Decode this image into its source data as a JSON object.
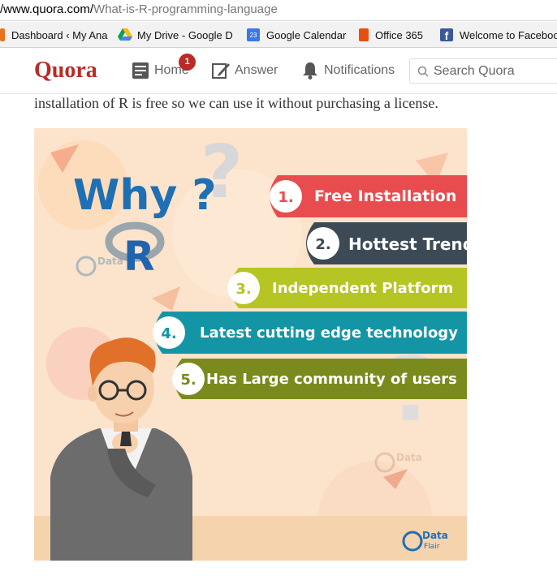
{
  "browser": {
    "url_prefix": "/www.quora.com/",
    "url_path": "What-is-R-programming-language",
    "bookmarks": [
      {
        "label": "Dashboard ‹ My Ana",
        "icon": "wordpress-icon"
      },
      {
        "label": "My Drive - Google D",
        "icon": "google-drive-icon"
      },
      {
        "label": "Google Calendar",
        "icon": "google-calendar-icon",
        "badge": "23"
      },
      {
        "label": "Office 365",
        "icon": "office365-icon"
      },
      {
        "label": "Welcome to Faceboo",
        "icon": "facebook-icon"
      }
    ]
  },
  "header": {
    "logo": "Quora",
    "nav": {
      "home": "Home",
      "home_badge": "1",
      "answer": "Answer",
      "notifications": "Notifications"
    },
    "search_placeholder": "Search Quora"
  },
  "answer": {
    "text": "installation of R is free so we can use it without purchasing a license."
  },
  "infographic": {
    "heading": "Why ?",
    "logo_letter": "R",
    "items": [
      {
        "num": "1.",
        "label": "Free Installation",
        "color": "#e84c4f"
      },
      {
        "num": "2.",
        "label": "Hottest Trend",
        "color": "#3c4a55"
      },
      {
        "num": "3.",
        "label": "Independent Platform",
        "color": "#b4c524"
      },
      {
        "num": "4.",
        "label": "Latest cutting edge technology",
        "color": "#1495a5"
      },
      {
        "num": "5.",
        "label": "Has Large community of users",
        "color": "#7a8a1c"
      }
    ],
    "brand_line1": "Data",
    "brand_line2": "Flair",
    "colors": {
      "background": "#fbe3cc",
      "floor": "#f5d3ad",
      "heading": "#1f6fb5",
      "hair": "#e1702b",
      "jacket": "#6c6c6c"
    }
  }
}
